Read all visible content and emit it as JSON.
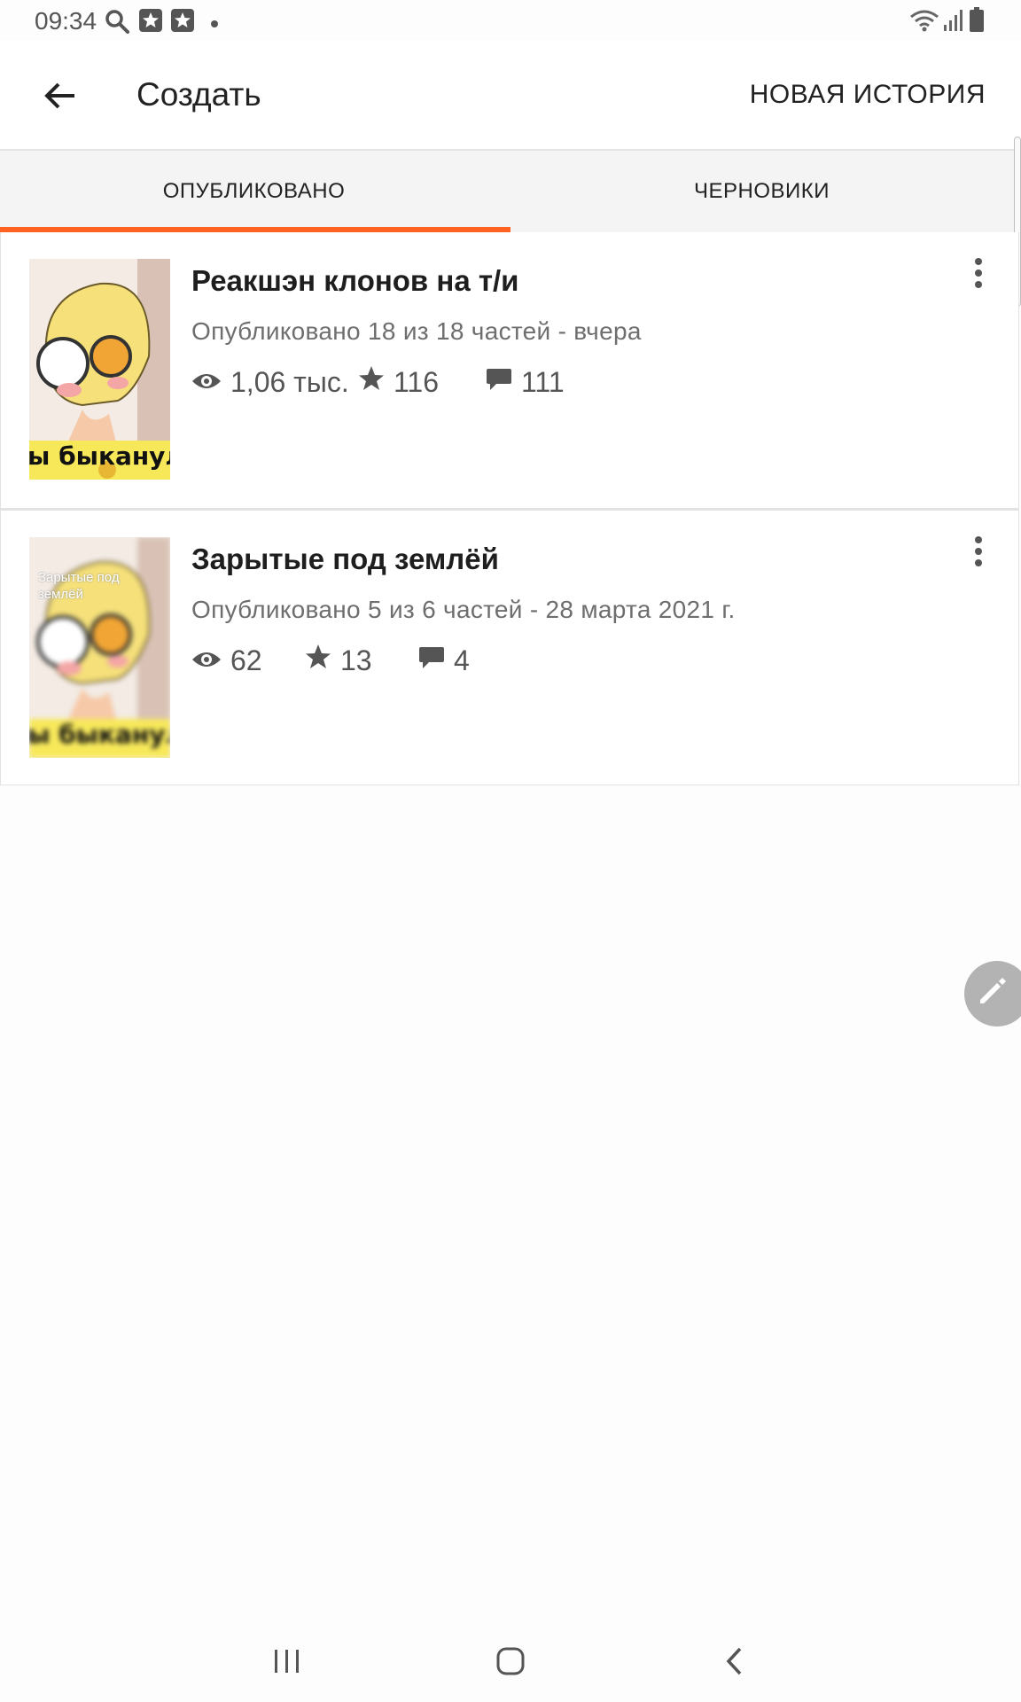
{
  "status_bar": {
    "time": "09:34",
    "left_icons": [
      "search-icon",
      "app-notification-icon",
      "app-notification-icon",
      "dot-icon"
    ],
    "right_icons": [
      "wifi-icon",
      "signal-icon",
      "battery-icon"
    ]
  },
  "app_bar": {
    "back_icon": "arrow-left-icon",
    "title": "Создать",
    "action_label": "НОВАЯ ИСТОРИЯ"
  },
  "tabs": [
    {
      "label": "ОПУБЛИКОВАНО",
      "active": true
    },
    {
      "label": "ЧЕРНОВИКИ",
      "active": false
    }
  ],
  "stories": [
    {
      "title": "Реакшэн клонов на т/и",
      "meta": "Опубликовано 18 из 18 частей - вчера",
      "views": "1,06 тыс.",
      "votes": "116",
      "comments": "111",
      "cover_text": "ы быканул",
      "cover_caption": ""
    },
    {
      "title": "Зарытые под землёй",
      "meta": "Опубликовано 5 из 6 частей - 28 марта 2021 г.",
      "views": "62",
      "votes": "13",
      "comments": "4",
      "cover_text": "ы быканул",
      "cover_caption": "Зарытые под землёй"
    }
  ],
  "fab_icon": "pencil-icon",
  "nav_bar": {
    "icons": [
      "recent-apps-icon",
      "home-icon",
      "back-icon"
    ]
  },
  "colors": {
    "accent": "#ff6122",
    "tab_background": "#f4f4f4",
    "fab": "#b3b3b3"
  }
}
